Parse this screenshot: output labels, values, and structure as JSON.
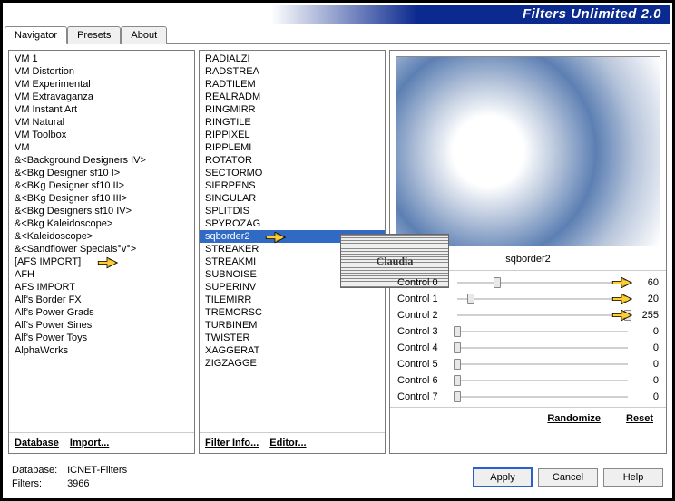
{
  "header": {
    "title": "Filters Unlimited 2.0"
  },
  "tabs": [
    {
      "label": "Navigator",
      "active": true
    },
    {
      "label": "Presets",
      "active": false
    },
    {
      "label": "About",
      "active": false
    }
  ],
  "categories": {
    "items": [
      "VM 1",
      "VM Distortion",
      "VM Experimental",
      "VM Extravaganza",
      "VM Instant Art",
      "VM Natural",
      "VM Toolbox",
      "VM",
      "&<Background Designers IV>",
      "&<Bkg Designer sf10 I>",
      "&<BKg Designer sf10 II>",
      "&<BKg Designer sf10 III>",
      "&<Bkg Designers sf10 IV>",
      "&<Bkg Kaleidoscope>",
      "&<Kaleidoscope>",
      "&<Sandflower Specials°v°>",
      "[AFS IMPORT]",
      "AFH",
      "AFS IMPORT",
      "Alf's Border FX",
      "Alf's Power Grads",
      "Alf's Power Sines",
      "Alf's Power Toys",
      "AlphaWorks"
    ],
    "selected_index": 16,
    "buttons": {
      "database": "Database",
      "import": "Import..."
    }
  },
  "filters": {
    "items": [
      "RADIALZI",
      "RADSTREA",
      "RADTILEM",
      "REALRADM",
      "RINGMIRR",
      "RINGTILE",
      "RIPPIXEL",
      "RIPPLEMI",
      "ROTATOR",
      "SECTORMO",
      "SIERPENS",
      "SINGULAR",
      "SPLITDIS",
      "SPYROZAG",
      "sqborder2",
      "STREAKER",
      "STREAKMI",
      "SUBNOISE",
      "SUPERINV",
      "TILEMIRR",
      "TREMORSC",
      "TURBINEM",
      "TWISTER",
      "XAGGERAT",
      "ZIGZAGGE"
    ],
    "selected_index": 14,
    "buttons": {
      "info": "Filter Info...",
      "editor": "Editor..."
    }
  },
  "right": {
    "filter_name": "sqborder2",
    "controls": [
      {
        "label": "Control 0",
        "value": 60
      },
      {
        "label": "Control 1",
        "value": 20
      },
      {
        "label": "Control 2",
        "value": 255
      },
      {
        "label": "Control 3",
        "value": 0
      },
      {
        "label": "Control 4",
        "value": 0
      },
      {
        "label": "Control 5",
        "value": 0
      },
      {
        "label": "Control 6",
        "value": 0
      },
      {
        "label": "Control 7",
        "value": 0
      }
    ],
    "randomize": "Randomize",
    "reset": "Reset"
  },
  "footer": {
    "db_label": "Database:",
    "db_value": "ICNET-Filters",
    "filters_label": "Filters:",
    "filters_value": "3966",
    "apply": "Apply",
    "cancel": "Cancel",
    "help": "Help"
  },
  "watermark": "Claudia"
}
